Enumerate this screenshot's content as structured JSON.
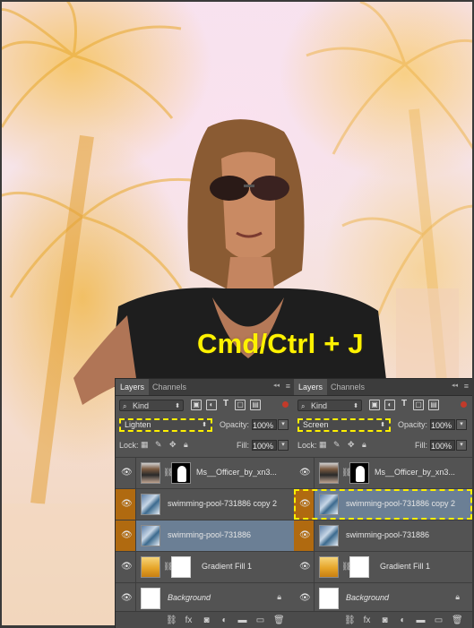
{
  "overlay": {
    "shortcut_text": "Cmd/Ctrl + J"
  },
  "panels": [
    {
      "tabs": [
        "Layers",
        "Channels"
      ],
      "kind": "Kind",
      "blend_mode": "Lighten",
      "opacity_label": "Opacity:",
      "opacity_value": "100%",
      "lock_label": "Lock:",
      "fill_label": "Fill:",
      "fill_value": "100%",
      "layers": [
        {
          "name": "Ms__Officer_by_xn3...",
          "thumb": "woman",
          "mask": true,
          "selected": false,
          "orange": false
        },
        {
          "name": "swimming-pool-731886 copy 2",
          "thumb": "photo",
          "mask": false,
          "selected": false,
          "orange": true
        },
        {
          "name": "swimming-pool-731886",
          "thumb": "photo",
          "mask": false,
          "selected": true,
          "orange": true
        },
        {
          "name": "Gradient Fill 1",
          "thumb": "gradient",
          "mask": true,
          "selected": false,
          "orange": false
        },
        {
          "name": "Background",
          "thumb": "white",
          "mask": false,
          "selected": false,
          "orange": false,
          "locked": true
        }
      ]
    },
    {
      "tabs": [
        "Layers",
        "Channels"
      ],
      "kind": "Kind",
      "blend_mode": "Screen",
      "opacity_label": "Opacity:",
      "opacity_value": "100%",
      "lock_label": "Lock:",
      "fill_label": "Fill:",
      "fill_value": "100%",
      "layers": [
        {
          "name": "Ms__Officer_by_xn3...",
          "thumb": "woman",
          "mask": true,
          "selected": false,
          "orange": false
        },
        {
          "name": "swimming-pool-731886 copy 2",
          "thumb": "photo",
          "mask": false,
          "selected": true,
          "orange": true
        },
        {
          "name": "swimming-pool-731886",
          "thumb": "photo",
          "mask": false,
          "selected": false,
          "orange": true
        },
        {
          "name": "Gradient Fill 1",
          "thumb": "gradient",
          "mask": true,
          "selected": false,
          "orange": false
        },
        {
          "name": "Background",
          "thumb": "white",
          "mask": false,
          "selected": false,
          "orange": false,
          "locked": true
        }
      ]
    }
  ],
  "bottom_icons": [
    "link-icon",
    "fx-icon",
    "mask-icon",
    "adjustment-icon",
    "group-icon",
    "new-layer-icon",
    "trash-icon"
  ]
}
